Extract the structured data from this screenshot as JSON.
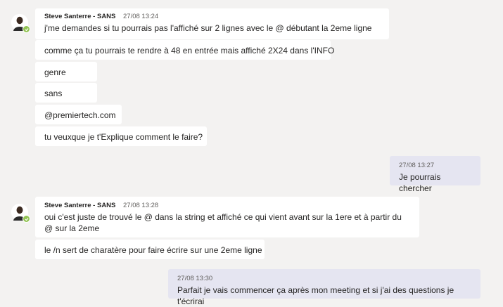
{
  "group1": {
    "author": "Steve Santerre - SANS",
    "time": "27/08 13:24",
    "messages": [
      "j'me demandes si tu pourrais pas l'affiché sur 2 lignes avec le @ débutant la 2eme ligne",
      "comme ça tu pourrais te rendre à 48 en entrée mais affiché 2X24 dans l'INFO",
      "genre",
      "sans",
      "@premiertech.com",
      "tu veuxque je t'Explique comment le faire?"
    ]
  },
  "reply1": {
    "time": "27/08 13:27",
    "text": "Je pourrais chercher"
  },
  "group2": {
    "author": "Steve Santerre - SANS",
    "time": "27/08 13:28",
    "messages": [
      "oui c'est juste de trouvé le @ dans la string et affiché ce qui vient avant sur la 1ere et à partir du @ sur la 2eme",
      "le /n sert de charatère pour faire écrire sur une 2eme ligne"
    ]
  },
  "reply2": {
    "time": "27/08 13:30",
    "text": "Parfait je vais commencer ça après mon meeting et si j'ai des questions je t'écrirai"
  },
  "icons": {
    "avatar": "user-avatar-icon",
    "status": "available-check-icon"
  },
  "colors": {
    "available": "#92c353",
    "my_bubble": "#e5e5f1",
    "their_bubble": "#ffffff",
    "background": "#f3f2f1"
  }
}
